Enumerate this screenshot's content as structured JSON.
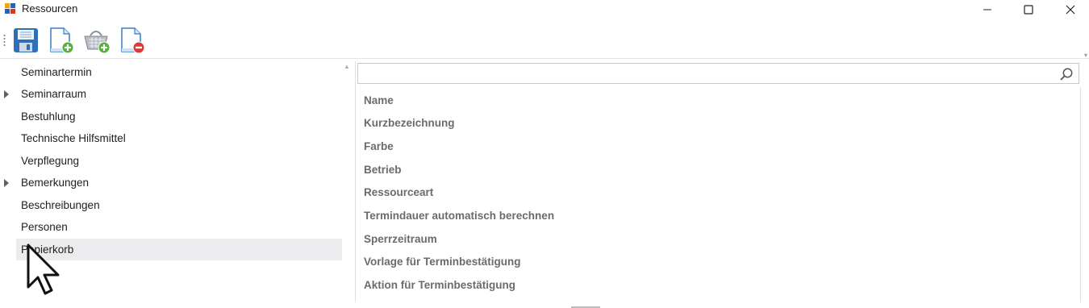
{
  "window": {
    "title": "Ressourcen"
  },
  "toolbar": {
    "buttons": [
      {
        "name": "save-button",
        "icon": "floppy-disk-icon"
      },
      {
        "name": "new-document-button",
        "icon": "document-add-icon"
      },
      {
        "name": "add-basket-button",
        "icon": "basket-add-icon"
      },
      {
        "name": "delete-document-button",
        "icon": "document-remove-icon"
      }
    ]
  },
  "tree": {
    "items": [
      {
        "label": "Seminartermin",
        "expandable": false
      },
      {
        "label": "Seminarraum",
        "expandable": true
      },
      {
        "label": "Bestuhlung",
        "expandable": false
      },
      {
        "label": "Technische Hilfsmittel",
        "expandable": false
      },
      {
        "label": "Verpflegung",
        "expandable": false
      },
      {
        "label": "Bemerkungen",
        "expandable": true
      },
      {
        "label": "Beschreibungen",
        "expandable": false
      },
      {
        "label": "Personen",
        "expandable": false
      },
      {
        "label": "Papierkorb",
        "expandable": false,
        "selected": true
      }
    ]
  },
  "search": {
    "value": "",
    "placeholder": ""
  },
  "properties": [
    "Name",
    "Kurzbezeichnung",
    "Farbe",
    "Betrieb",
    "Ressourceart",
    "Termindauer automatisch berechnen",
    "Sperrzeitraum",
    "Vorlage für Terminbestätigung",
    "Aktion für Terminbestätigung"
  ],
  "colors": {
    "selection": "#ececee",
    "property_text": "#6b6b6b",
    "border": "#c8c8c8"
  }
}
